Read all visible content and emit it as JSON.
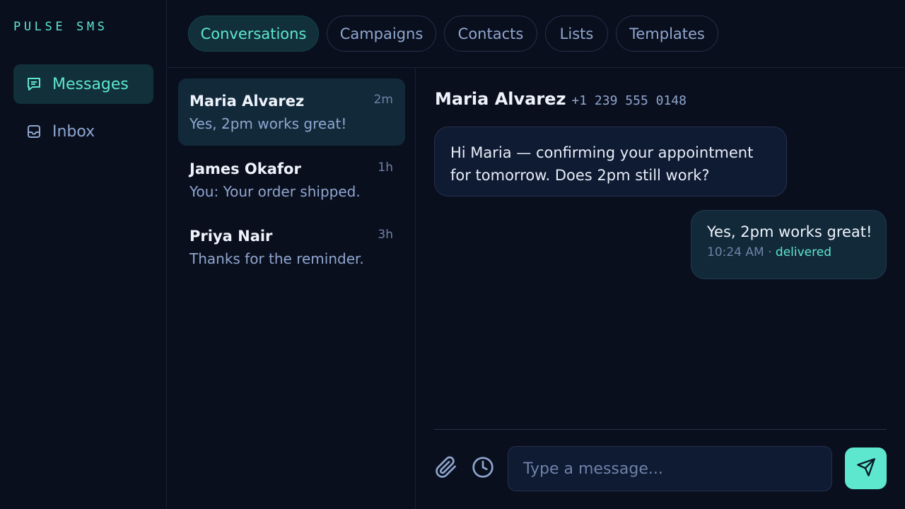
{
  "brand": "PULSE SMS",
  "sidebar": {
    "items": [
      {
        "label": "Messages",
        "icon": "message-icon",
        "active": true
      },
      {
        "label": "Inbox",
        "icon": "inbox-icon",
        "active": false
      }
    ]
  },
  "tabs": [
    {
      "label": "Conversations",
      "active": true
    },
    {
      "label": "Campaigns",
      "active": false
    },
    {
      "label": "Contacts",
      "active": false
    },
    {
      "label": "Lists",
      "active": false
    },
    {
      "label": "Templates",
      "active": false
    }
  ],
  "conversations": [
    {
      "name": "Maria Alvarez",
      "preview": "Yes, 2pm works great!",
      "time": "2m",
      "active": true
    },
    {
      "name": "James Okafor",
      "preview": "You: Your order shipped.",
      "time": "1h",
      "active": false
    },
    {
      "name": "Priya Nair",
      "preview": "Thanks for the reminder.",
      "time": "3h",
      "active": false
    }
  ],
  "thread": {
    "name": "Maria Alvarez",
    "phone": "+1 239 555 0148",
    "messages": [
      {
        "direction": "outgoing-sent",
        "text": "Hi Maria — confirming your appointment for tomorrow. Does 2pm still work?"
      },
      {
        "direction": "incoming-reply",
        "text": "Yes, 2pm works great!",
        "time": "10:24 AM",
        "separator": "·",
        "status": "delivered"
      }
    ]
  },
  "composer": {
    "placeholder": "Type a message...",
    "attach_icon": "paperclip-icon",
    "schedule_icon": "clock-icon",
    "send_icon": "send-icon"
  },
  "colors": {
    "accent": "#5ee7cf",
    "background": "#0a0f1e",
    "muted": "#8fa6cf"
  }
}
